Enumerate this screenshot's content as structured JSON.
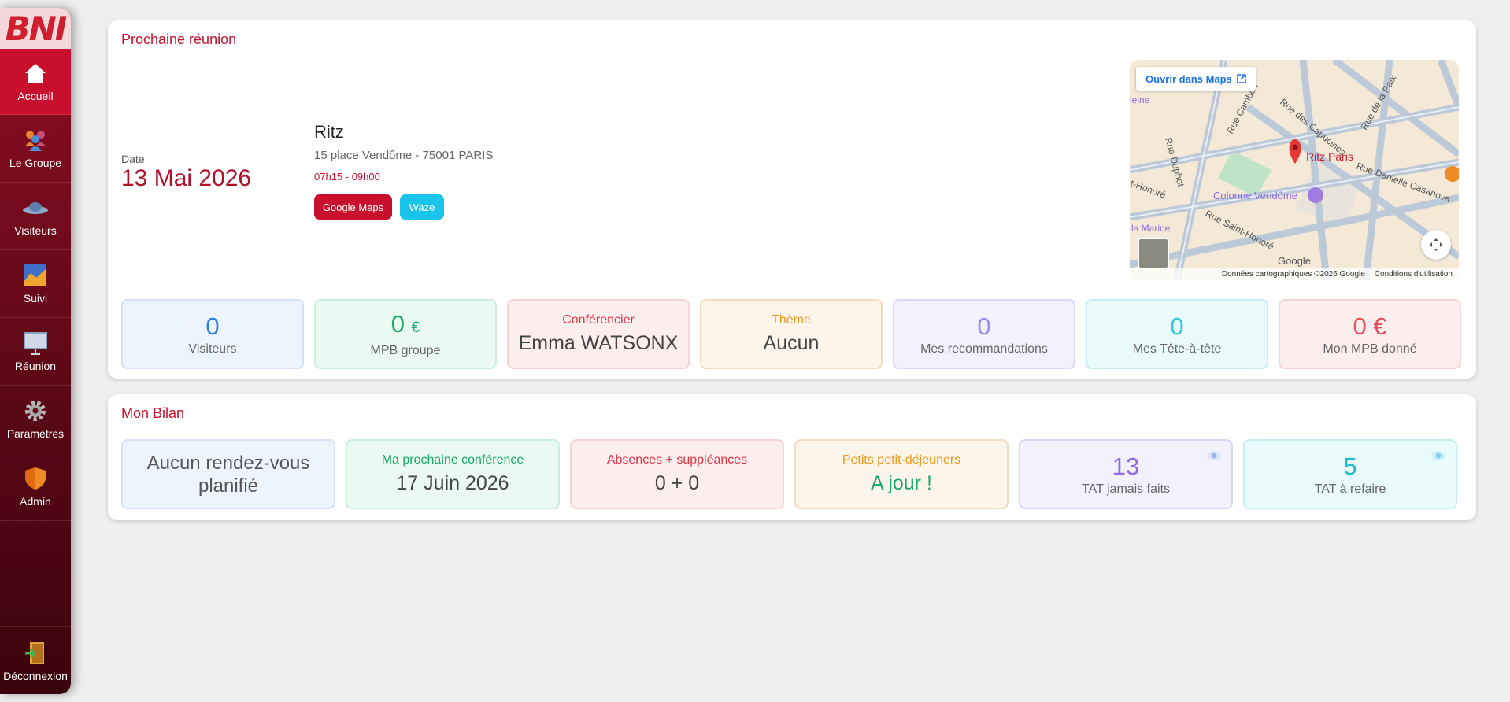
{
  "sidebar": {
    "logo": "BNI",
    "items": [
      {
        "label": "Accueil",
        "icon": "home-icon"
      },
      {
        "label": "Le Groupe",
        "icon": "group-icon"
      },
      {
        "label": "Visiteurs",
        "icon": "visitors-icon"
      },
      {
        "label": "Suivi",
        "icon": "chart-icon"
      },
      {
        "label": "Réunion",
        "icon": "presentation-icon"
      },
      {
        "label": "Paramètres",
        "icon": "gear-icon"
      },
      {
        "label": "Admin",
        "icon": "shield-icon"
      }
    ],
    "logout": {
      "label": "Déconnexion",
      "icon": "logout-icon"
    }
  },
  "meeting": {
    "title": "Prochaine réunion",
    "date_label": "Date",
    "date": "13 Mai 2026",
    "venue": "Ritz",
    "address": "15 place Vendôme - 75001 PARIS",
    "time": "07h15 - 09h00",
    "btn_gmaps": "Google Maps",
    "btn_waze": "Waze"
  },
  "map": {
    "open_label": "Ouvrir dans Maps",
    "place": "Ritz Paris",
    "landmark": "Colonne Vendôme",
    "streets": [
      "Rue des Capucines",
      "Rue Cambon",
      "Rue de la Paix",
      "Rue Danielle Casanova",
      "Rue Saint-Honoré",
      "Rue Duphot",
      "t-Honoré",
      "la Marine",
      "leine"
    ],
    "footer": [
      "Données cartographiques ©2026 Google",
      "Conditions d'utilisation"
    ],
    "brand": "Google"
  },
  "stats": [
    {
      "value": "0",
      "label": "Visiteurs",
      "color": "#2b7de9"
    },
    {
      "value": "0",
      "unit": "€",
      "label": "MPB groupe",
      "color": "#1aa86a"
    },
    {
      "head": "Conférencier",
      "value": "Emma WATSONX",
      "color": "#e03545"
    },
    {
      "head": "Thème",
      "value": "Aucun",
      "color": "#ee9a1a"
    },
    {
      "value": "0",
      "label": "Mes recommandations",
      "color": "#9b8ee8"
    },
    {
      "value": "0",
      "label": "Mes Tête-à-tête",
      "color": "#2fc7d6"
    },
    {
      "value": "0 €",
      "label": "Mon MPB donné",
      "color": "#e5505b"
    }
  ],
  "bilan": {
    "title": "Mon Bilan",
    "cards": [
      {
        "value": "Aucun rendez-vous planifié"
      },
      {
        "head": "Ma prochaine conférence",
        "value": "17 Juin 2026",
        "color": "#1aa86a"
      },
      {
        "head": "Absences + suppléances",
        "value": "0 + 0",
        "color": "#e03545"
      },
      {
        "head": "Petits petit-déjeuners",
        "value": "A jour !",
        "color": "#ee9a1a",
        "value_color": "#1aa86a"
      },
      {
        "value": "13",
        "label": "TAT jamais faits",
        "color": "#8e6be6"
      },
      {
        "value": "5",
        "label": "TAT à refaire",
        "color": "#1cb8cc"
      }
    ]
  }
}
